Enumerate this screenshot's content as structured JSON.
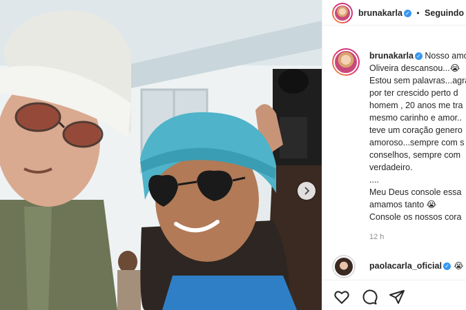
{
  "header": {
    "username": "brunakarla",
    "separator": "•",
    "follow_state": "Seguindo"
  },
  "caption": {
    "username": "brunakarla",
    "lines": [
      "Nosso amo",
      "Oliveira descansou...😭",
      "Estou sem palavras...agra",
      "por ter crescido perto d",
      "homem , 20 anos me tra",
      "mesmo carinho e amor..",
      "teve um coração genero",
      "amoroso...sempre com s",
      "conselhos, sempre com",
      "verdadeiro.",
      "....",
      "Meu Deus console essa",
      "amamos tanto 😭",
      "Console os nossos cora"
    ],
    "timestamp": "12 h"
  },
  "comment": {
    "username": "paolacarla_oficial",
    "text": "😭"
  },
  "icons": {
    "like": "heart-icon",
    "comment": "comment-icon",
    "share": "share-icon",
    "carousel_next": "chevron-right-icon",
    "verified": "verified-badge-icon"
  },
  "colors": {
    "verified": "#3897f0",
    "text": "#262626",
    "muted": "#8e8e8e",
    "divider": "#efefef"
  }
}
